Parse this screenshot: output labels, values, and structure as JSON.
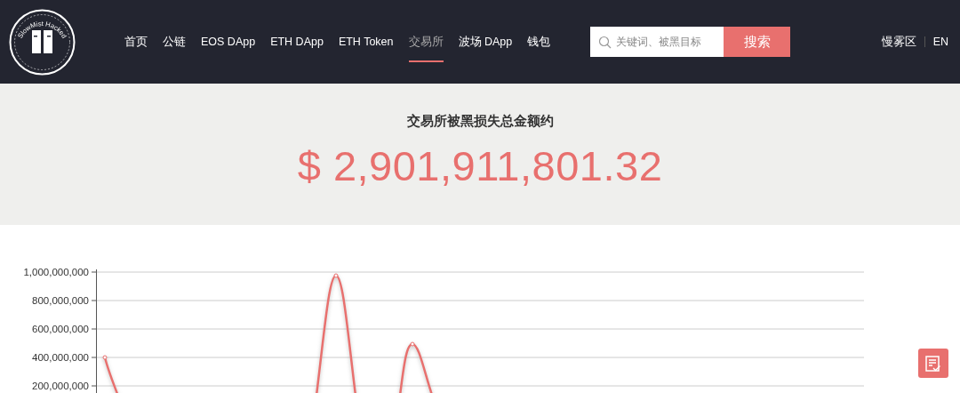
{
  "logo": {
    "ring_text": "SlowMist Hacked"
  },
  "nav": [
    {
      "label": "首页",
      "selected": false
    },
    {
      "label": "公链",
      "selected": false
    },
    {
      "label": "EOS DApp",
      "selected": false
    },
    {
      "label": "ETH DApp",
      "selected": false
    },
    {
      "label": "ETH Token",
      "selected": false
    },
    {
      "label": "交易所",
      "selected": true
    },
    {
      "label": "波场 DApp",
      "selected": false
    },
    {
      "label": "钱包",
      "selected": false
    }
  ],
  "search": {
    "placeholder": "关键词、被黑目标",
    "button": "搜索"
  },
  "links": [
    "慢雾区",
    "EN"
  ],
  "banner": {
    "title": "交易所被黑损失总金额约",
    "amount": "$ 2,901,911,801.32"
  },
  "chart": {
    "kind": "picture",
    "y_axis_labels": [
      "1,000,000,000",
      "800,000,000",
      "600,000,000",
      "400,000,000",
      "200,000,000"
    ]
  }
}
